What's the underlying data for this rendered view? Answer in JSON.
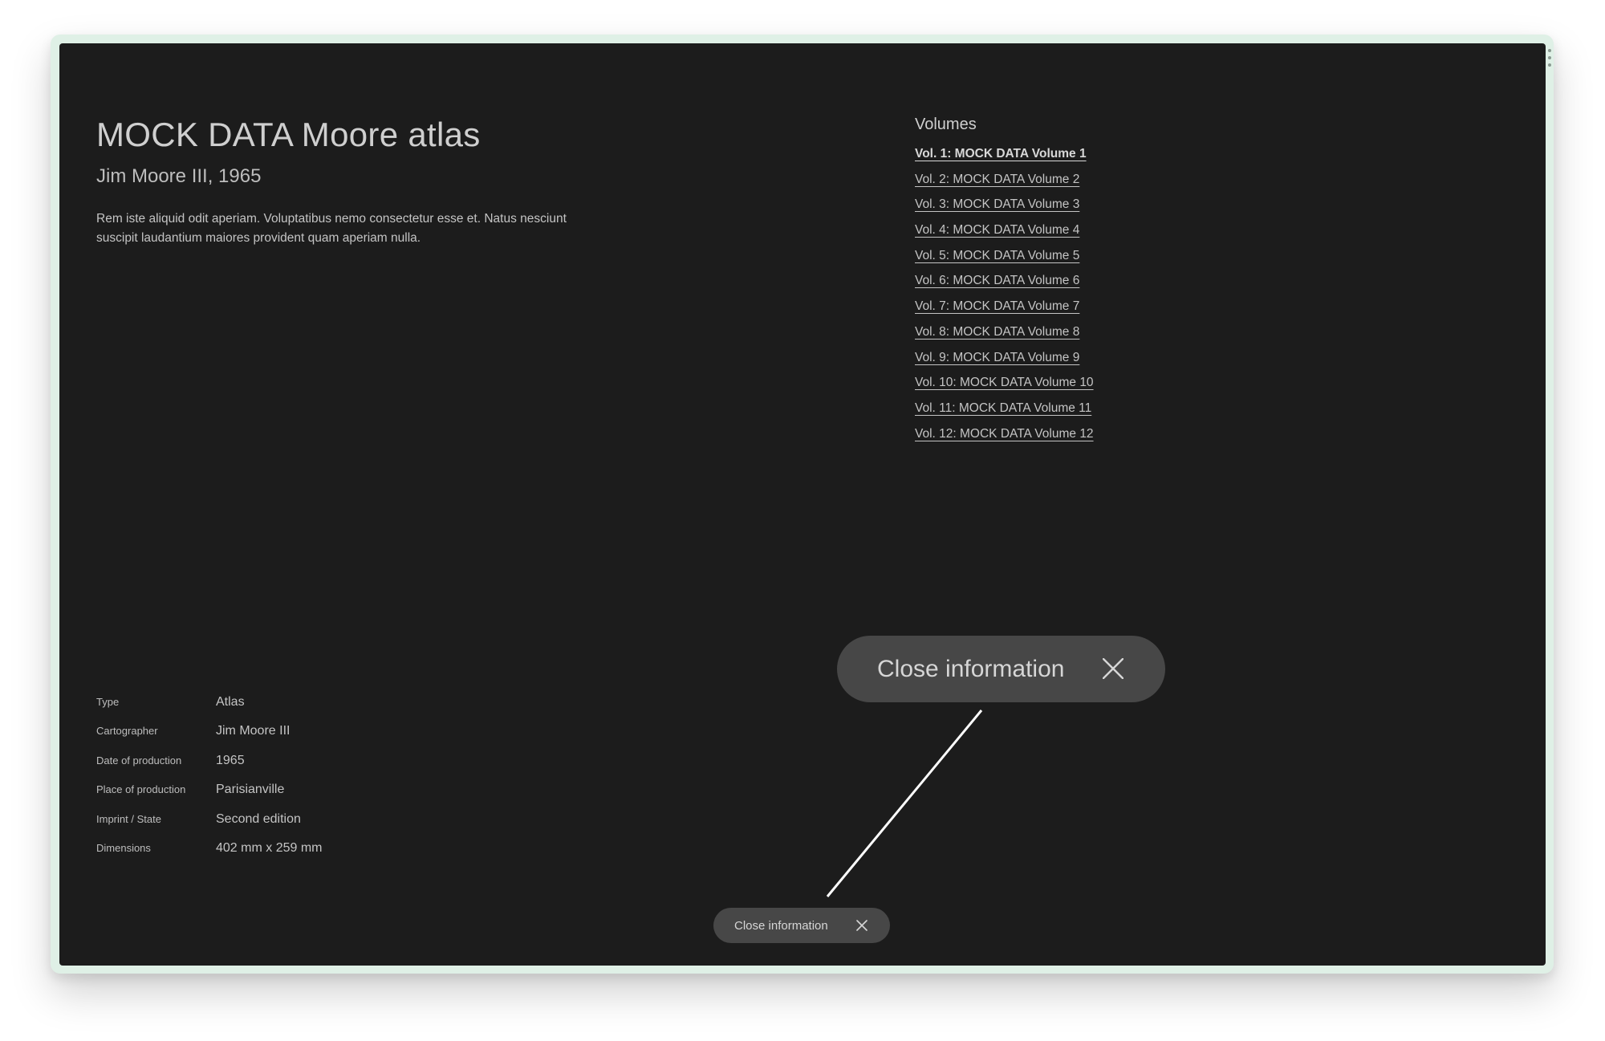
{
  "atlas": {
    "title": "MOCK DATA Moore atlas",
    "subtitle": "Jim Moore III, 1965",
    "description": "Rem iste aliquid odit aperiam. Voluptatibus nemo consectetur esse et. Natus nesciunt suscipit laudantium maiores provident quam aperiam nulla."
  },
  "volumes": {
    "heading": "Volumes",
    "items": [
      {
        "label": "Vol. 1: MOCK DATA Volume 1",
        "active": true
      },
      {
        "label": "Vol. 2: MOCK DATA Volume 2",
        "active": false
      },
      {
        "label": "Vol. 3: MOCK DATA Volume 3",
        "active": false
      },
      {
        "label": "Vol. 4: MOCK DATA Volume 4",
        "active": false
      },
      {
        "label": "Vol. 5: MOCK DATA Volume 5",
        "active": false
      },
      {
        "label": "Vol. 6: MOCK DATA Volume 6",
        "active": false
      },
      {
        "label": "Vol. 7: MOCK DATA Volume 7",
        "active": false
      },
      {
        "label": "Vol. 8: MOCK DATA Volume 8",
        "active": false
      },
      {
        "label": "Vol. 9: MOCK DATA Volume 9",
        "active": false
      },
      {
        "label": "Vol. 10: MOCK DATA Volume 10",
        "active": false
      },
      {
        "label": "Vol. 11: MOCK DATA Volume 11",
        "active": false
      },
      {
        "label": "Vol. 12: MOCK DATA Volume 12",
        "active": false
      }
    ]
  },
  "details": [
    {
      "label": "Type",
      "value": "Atlas"
    },
    {
      "label": "Cartographer",
      "value": "Jim Moore III"
    },
    {
      "label": "Date of production",
      "value": "1965"
    },
    {
      "label": "Place of production",
      "value": "Parisianville"
    },
    {
      "label": "Imprint / State",
      "value": "Second edition"
    },
    {
      "label": "Dimensions",
      "value": "402 mm x 259 mm"
    }
  ],
  "close_button": {
    "label": "Close information",
    "icon": "close-icon"
  },
  "callout": {
    "label": "Close information",
    "icon": "close-icon"
  },
  "colors": {
    "background": "#1c1c1c",
    "frame": "#dff0e6",
    "pill": "#474747",
    "text": "#c4c4c4"
  }
}
